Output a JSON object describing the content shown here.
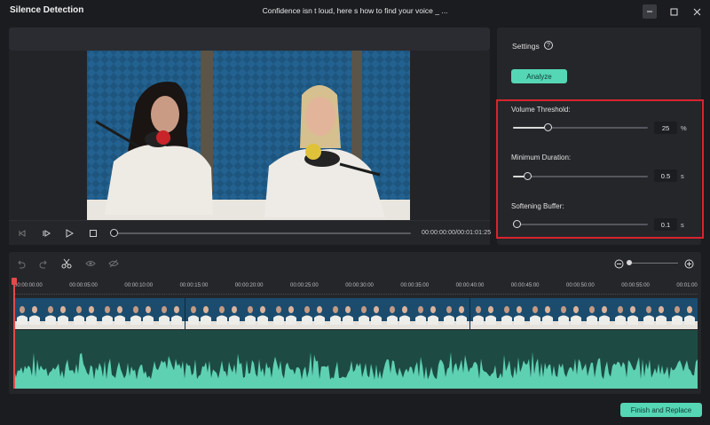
{
  "window": {
    "app_title": "Silence Detection",
    "doc_title": "Confidence isn t loud, here s how to find your voice _ ..."
  },
  "player": {
    "timecode": "00:00:00:00/00:01:01:25",
    "progress": 0
  },
  "settings": {
    "label": "Settings",
    "help_glyph": "?",
    "analyze_label": "Analyze",
    "params": [
      {
        "label": "Volume Threshold:",
        "value": "25",
        "unit": "%",
        "fraction": 0.26
      },
      {
        "label": "Minimum Duration:",
        "value": "0.5",
        "unit": "s",
        "fraction": 0.11
      },
      {
        "label": "Softening Buffer:",
        "value": "0.1",
        "unit": "s",
        "fraction": 0.03
      }
    ]
  },
  "timeline": {
    "ruler": [
      "00:00:00:00",
      "00:00:05:00",
      "00:00:10:00",
      "00:00:15:00",
      "00:00:20:00",
      "00:00:25:00",
      "00:00:30:00",
      "00:00:35:00",
      "00:00:40:00",
      "00:00:45:00",
      "00:00:50:00",
      "00:00:55:00",
      "00:01:00"
    ],
    "zoom_level": 0.05
  },
  "footer": {
    "finish_label": "Finish and Replace"
  },
  "colors": {
    "accent": "#55d6b5",
    "highlight_border": "#d8242d",
    "playhead": "#e34a4a",
    "waveform": "#5ed1b3"
  }
}
